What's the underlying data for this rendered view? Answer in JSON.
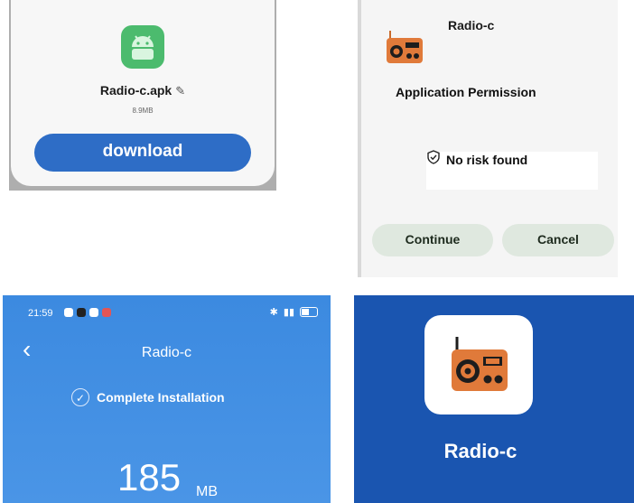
{
  "download_card": {
    "file_name": "Radio-c.apk",
    "edit_icon": "pencil-icon",
    "file_size": "8.9MB",
    "download_label": "download",
    "app_icon": "android-icon",
    "accent": "#2e6dc6"
  },
  "permission_dialog": {
    "app_name": "Radio-c",
    "app_icon": "radio-icon",
    "title": "Application Permission",
    "risk_icon": "shield-check-icon",
    "risk_text": "No risk found",
    "continue_label": "Continue",
    "cancel_label": "Cancel",
    "button_color": "#dfe8df"
  },
  "install_screen": {
    "status_time": "21:59",
    "back_icon": "chevron-left-icon",
    "title": "Radio-c",
    "check_icon": "check-circle-icon",
    "status_text": "Complete Installation",
    "size_value": "185",
    "size_unit": "MB",
    "background": "#3c8ae0"
  },
  "app_tile": {
    "icon": "radio-icon",
    "label": "Radio-c",
    "background": "#1a55b0"
  }
}
